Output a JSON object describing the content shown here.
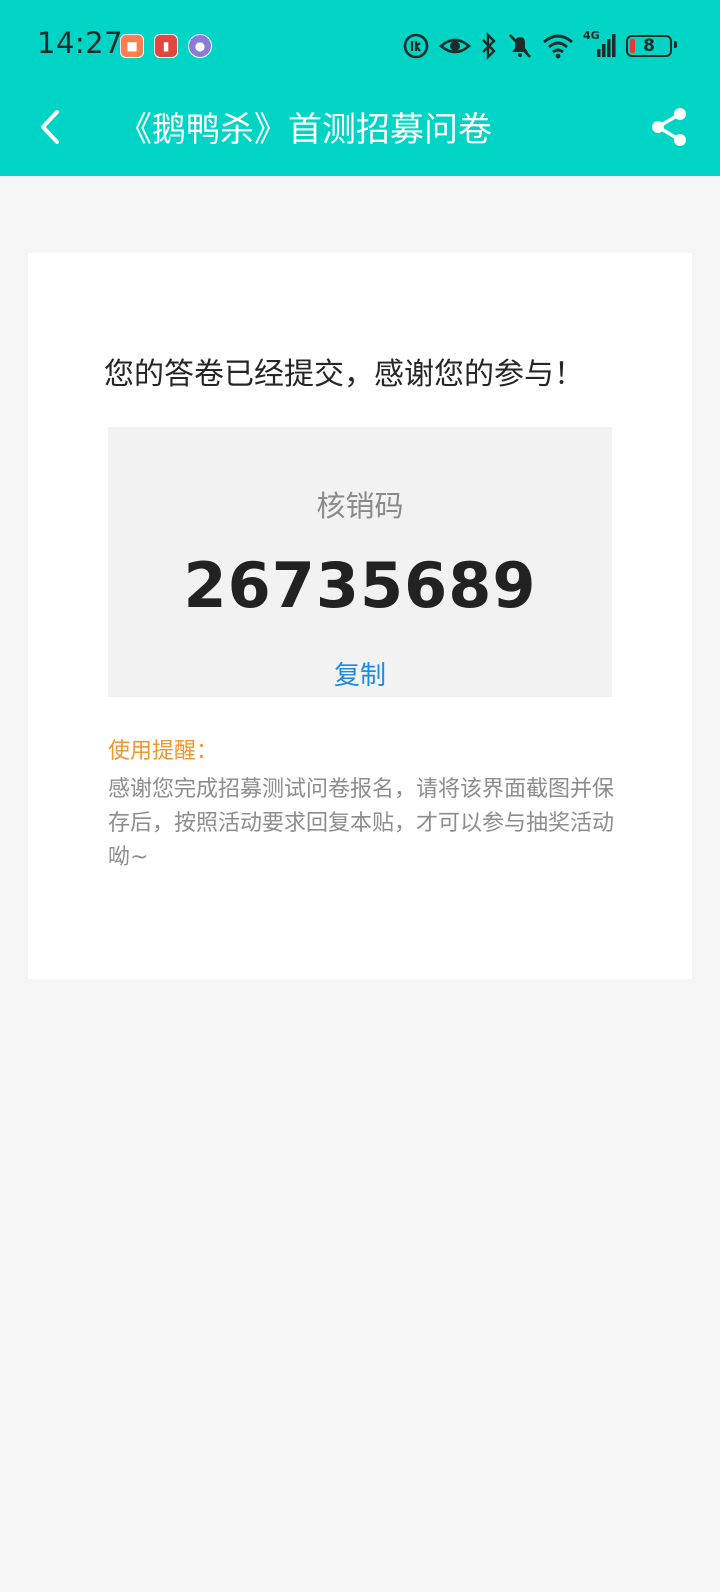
{
  "status_bar": {
    "time": "14:27",
    "battery_level": "8",
    "network_label": "4G",
    "icons": [
      "hd-call-icon",
      "eye-icon",
      "bluetooth-icon",
      "mute-icon",
      "wifi-icon",
      "cellular-signal-icon",
      "battery-icon"
    ],
    "app_badges": [
      "app-badge-1",
      "app-badge-2",
      "app-badge-3"
    ]
  },
  "navbar": {
    "title": "《鹅鸭杀》首测招募问卷",
    "back_icon": "chevron-left-icon",
    "share_icon": "share-icon"
  },
  "result": {
    "message": "您的答卷已经提交，感谢您的参与！",
    "code_label": "核销码",
    "code_value": "26735689",
    "copy_label": "复制"
  },
  "tip": {
    "title": "使用提醒：",
    "body": "感谢您完成招募测试问卷报名，请将该界面截图并保存后，按照活动要求回复本贴，才可以参与抽奖活动呦~"
  },
  "colors": {
    "header": "#00d4c4",
    "background": "#f5f5f5",
    "card": "#ffffff",
    "code_box": "#f2f2f2",
    "link": "#1e88e5",
    "tip_title": "#f0962c",
    "battery_low": "#e53935"
  }
}
